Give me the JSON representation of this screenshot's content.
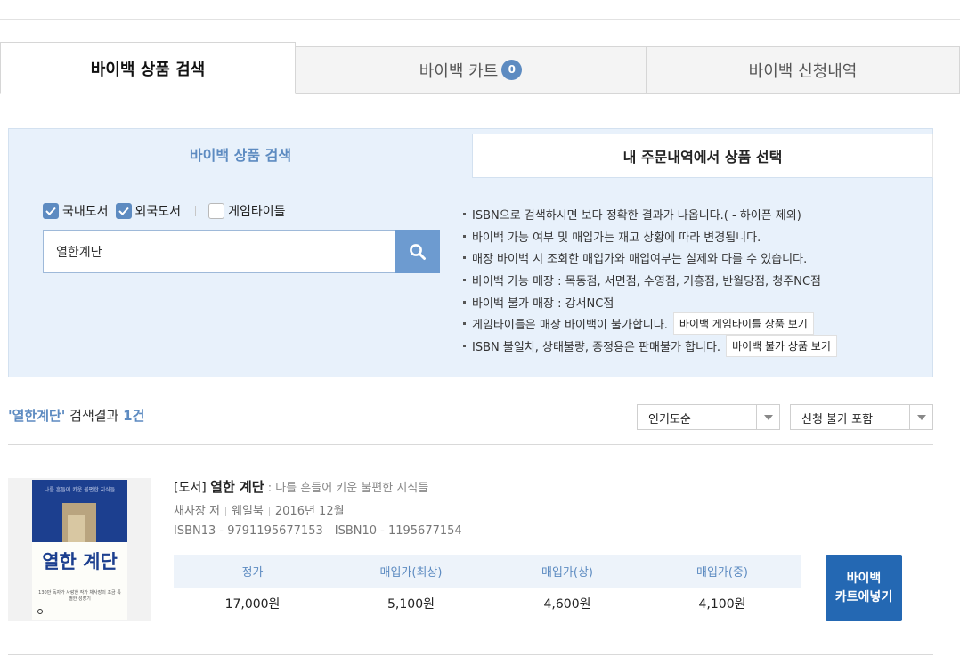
{
  "tabs": {
    "buyback_search": "바이백 상품 검색",
    "buyback_cart": "바이백 카트",
    "cart_count": "0",
    "buyback_history": "바이백 신청내역"
  },
  "search_panel": {
    "tab_search": "바이백 상품 검색",
    "tab_orders": "내 주문내역에서 상품 선택",
    "filters": [
      {
        "label": "국내도서",
        "checked": true
      },
      {
        "label": "외국도서",
        "checked": true
      },
      {
        "label": "게임타이틀",
        "checked": false
      }
    ],
    "query": "열한계단",
    "notes": [
      "ISBN으로 검색하시면 보다 정확한 결과가 나옵니다.( - 하이픈 제외)",
      "바이백 가능 여부 및 매입가는 재고 상황에 따라 변경됩니다.",
      "매장 바이백 시 조회한 매입가와 매입여부는 실제와 다를 수 있습니다.",
      "바이백 가능 매장 : 목동점, 서면점, 수영점, 기흥점, 반월당점, 청주NC점",
      "바이백 불가 매장 : 강서NC점",
      "게임타이틀은 매장 바이백이 불가합니다.",
      "ISBN 불일치, 상태불량, 증정용은 판매불가 합니다."
    ],
    "game_titles_button": "바이백 게임타이틀 상품 보기",
    "unavailable_button": "바이백 불가 상품 보기"
  },
  "results": {
    "query_quoted": "'열한계단'",
    "label": " 검색결과 ",
    "count": "1건",
    "sort_option": "인기도순",
    "filter_option": "신청 불가 포함"
  },
  "product": {
    "category": "[도서]",
    "title": "열한 계단",
    "subtitle": " : 나를 흔들어 키운 불편한 지식들",
    "author": "채사장 저",
    "publisher": "웨일북",
    "date": "2016년 12월",
    "isbn13": "ISBN13 - 9791195677153",
    "isbn10": "ISBN10 - 1195677154",
    "cover_title": "열한 계단",
    "cover_topline": "나를 흔들어 키운 불편한 지식들",
    "cover_blurb": "130만 독자가 사랑한 작가 채사장의 조금 특별한 성장기",
    "price_headers": [
      "정가",
      "매입가(최상)",
      "매입가(상)",
      "매입가(중)"
    ],
    "prices": [
      "17,000원",
      "5,100원",
      "4,600원",
      "4,100원"
    ],
    "cart_button_line1": "바이백",
    "cart_button_line2": "카트에넣기"
  },
  "colors": {
    "accent": "#5d8bc1",
    "cart_button": "#2468b3",
    "panel_bg": "#e8f1fb"
  }
}
